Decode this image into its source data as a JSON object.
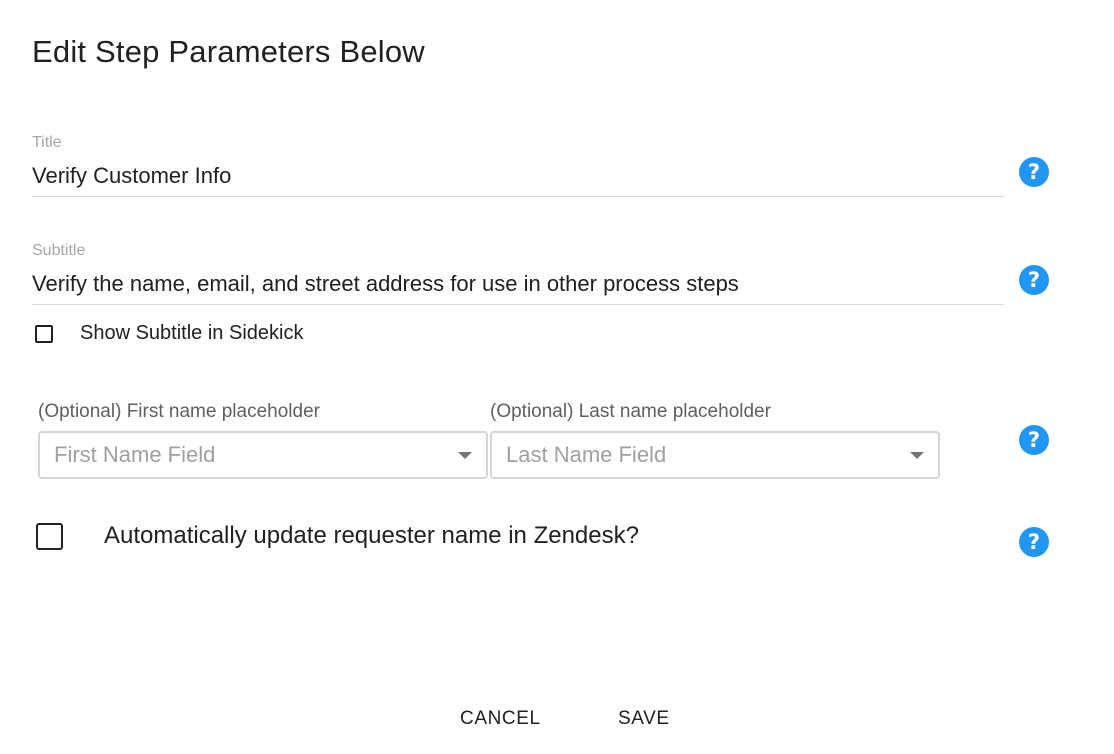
{
  "dialog": {
    "title": "Edit Step Parameters Below"
  },
  "fields": {
    "title": {
      "label": "Title",
      "value": "Verify Customer Info",
      "help_icon": "help-circle-icon"
    },
    "subtitle": {
      "label": "Subtitle",
      "value": "Verify the name, email, and street address for use in other process steps",
      "help_icon": "help-circle-icon"
    }
  },
  "show_subtitle_checkbox": {
    "label": "Show Subtitle in Sidekick",
    "checked": false
  },
  "name_selects": {
    "first": {
      "label": "(Optional) First name placeholder",
      "placeholder": "First Name Field"
    },
    "last": {
      "label": "(Optional) Last name placeholder",
      "placeholder": "Last Name Field"
    },
    "help_icon": "help-circle-icon"
  },
  "update_requester_checkbox": {
    "label": "Automatically update requester name in Zendesk?",
    "checked": false,
    "help_icon": "help-circle-icon"
  },
  "actions": {
    "cancel_label": "CANCEL",
    "save_label": "SAVE"
  },
  "help_glyph": "?",
  "colors": {
    "help_icon": "#2196f3",
    "text": "#212121",
    "label": "#a6a6a6",
    "underline": "#d9d9d9"
  }
}
